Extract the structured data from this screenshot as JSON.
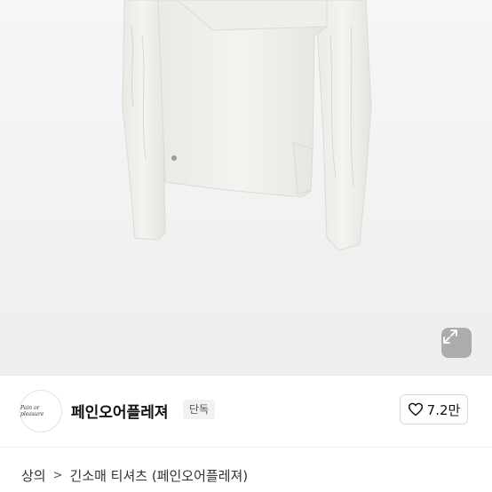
{
  "product": {
    "image_alt": "ivory long sleeve asymmetric top",
    "expand_icon": "expand-arrows-icon"
  },
  "brand": {
    "logo_text": "Pain or pleasure",
    "name": "페인오어플레져",
    "badge": "단독",
    "likes": "7.2만",
    "like_icon": "heart-outline-icon"
  },
  "breadcrumb": {
    "category": "상의",
    "separator": ">",
    "current": "긴소매 티셔츠 (페인오어플레져)"
  }
}
